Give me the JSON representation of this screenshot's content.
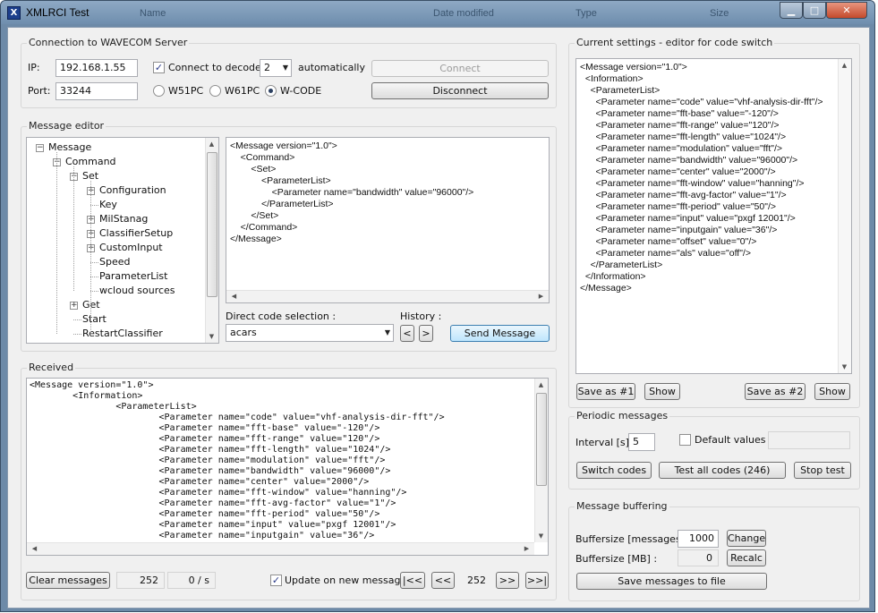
{
  "window": {
    "title": "XMLRCI Test",
    "bg_header": [
      "Name",
      "Date modified",
      "Type",
      "Size"
    ]
  },
  "connection": {
    "group_label": "Connection to WAVECOM Server",
    "ip_label": "IP:",
    "ip_value": "192.168.1.55",
    "port_label": "Port:",
    "port_value": "33244",
    "connect_decoder_label": "Connect to decoder",
    "connect_decoder_checked": true,
    "decoder_number": "2",
    "automatically_label": "automatically",
    "radio_w51pc": "W51PC",
    "radio_w61pc": "W61PC",
    "radio_wcode": "W-CODE",
    "selected_radio": "W-CODE",
    "connect_button": "Connect",
    "disconnect_button": "Disconnect"
  },
  "editor": {
    "group_label": "Message editor",
    "tree": [
      {
        "label": "Message",
        "toggle": "−"
      },
      {
        "label": "Command",
        "toggle": "−"
      },
      {
        "label": "Set",
        "toggle": "−"
      },
      {
        "label": "Configuration",
        "toggle": "+"
      },
      {
        "label": "Key",
        "toggle": ""
      },
      {
        "label": "MilStanag",
        "toggle": "+"
      },
      {
        "label": "ClassifierSetup",
        "toggle": "+"
      },
      {
        "label": "CustomInput",
        "toggle": "+"
      },
      {
        "label": "Speed",
        "toggle": ""
      },
      {
        "label": "ParameterList",
        "toggle": ""
      },
      {
        "label": "wcloud sources",
        "toggle": ""
      },
      {
        "label": "Get",
        "toggle": "+"
      },
      {
        "label": "Start",
        "toggle": ""
      },
      {
        "label": "RestartClassifier",
        "toggle": ""
      }
    ],
    "xml_lines": [
      "<Message version=\"1.0\">",
      "    <Command>",
      "        <Set>",
      "            <ParameterList>",
      "                <Parameter name=\"bandwidth\" value=\"96000\"/>",
      "            </ParameterList>",
      "        </Set>",
      "    </Command>",
      "</Message>"
    ],
    "direct_code_label": "Direct code selection :",
    "direct_code_value": "acars",
    "history_label": "History :",
    "history_prev": "<",
    "history_next": ">",
    "send_button": "Send Message"
  },
  "received": {
    "group_label": "Received",
    "lines": [
      "<Message version=\"1.0\">",
      "\t<Information>",
      "\t\t<ParameterList>",
      "\t\t\t<Parameter name=\"code\" value=\"vhf-analysis-dir-fft\"/>",
      "\t\t\t<Parameter name=\"fft-base\" value=\"-120\"/>",
      "\t\t\t<Parameter name=\"fft-range\" value=\"120\"/>",
      "\t\t\t<Parameter name=\"fft-length\" value=\"1024\"/>",
      "\t\t\t<Parameter name=\"modulation\" value=\"fft\"/>",
      "\t\t\t<Parameter name=\"bandwidth\" value=\"96000\"/>",
      "\t\t\t<Parameter name=\"center\" value=\"2000\"/>",
      "\t\t\t<Parameter name=\"fft-window\" value=\"hanning\"/>",
      "\t\t\t<Parameter name=\"fft-avg-factor\" value=\"1\"/>",
      "\t\t\t<Parameter name=\"fft-period\" value=\"50\"/>",
      "\t\t\t<Parameter name=\"input\" value=\"pxgf 12001\"/>",
      "\t\t\t<Parameter name=\"inputgain\" value=\"36\"/>"
    ],
    "clear_button": "Clear messages",
    "message_count": "252",
    "rate": "0 / s",
    "update_label": "Update on new message",
    "update_checked": true,
    "nav_first": "|<<",
    "nav_prev": "<<",
    "nav_position": "252",
    "nav_next": ">>",
    "nav_last": ">>|"
  },
  "current": {
    "group_label": "Current settings - editor for code switch",
    "lines": [
      "<Message version=\"1.0\">",
      "  <Information>",
      "    <ParameterList>",
      "      <Parameter name=\"code\" value=\"vhf-analysis-dir-fft\"/>",
      "      <Parameter name=\"fft-base\" value=\"-120\"/>",
      "      <Parameter name=\"fft-range\" value=\"120\"/>",
      "      <Parameter name=\"fft-length\" value=\"1024\"/>",
      "      <Parameter name=\"modulation\" value=\"fft\"/>",
      "      <Parameter name=\"bandwidth\" value=\"96000\"/>",
      "      <Parameter name=\"center\" value=\"2000\"/>",
      "      <Parameter name=\"fft-window\" value=\"hanning\"/>",
      "      <Parameter name=\"fft-avg-factor\" value=\"1\"/>",
      "      <Parameter name=\"fft-period\" value=\"50\"/>",
      "      <Parameter name=\"input\" value=\"pxgf 12001\"/>",
      "      <Parameter name=\"inputgain\" value=\"36\"/>",
      "      <Parameter name=\"offset\" value=\"0\"/>",
      "      <Parameter name=\"als\" value=\"off\"/>",
      "    </ParameterList>",
      "  </Information>",
      "</Message>"
    ],
    "save1_button": "Save as #1",
    "show1_button": "Show",
    "save2_button": "Save as #2",
    "show2_button": "Show"
  },
  "periodic": {
    "group_label": "Periodic messages",
    "interval_label": "Interval [s] :",
    "interval_value": "5",
    "default_values_label": "Default values",
    "default_values_checked": false,
    "switch_codes_button": "Switch codes",
    "test_all_button": "Test all codes (246)",
    "stop_test_button": "Stop test"
  },
  "buffering": {
    "group_label": "Message buffering",
    "buffersize_msgs_label": "Buffersize [messages] :",
    "buffersize_msgs_value": "1000",
    "change_button": "Change",
    "buffersize_mb_label": "Buffersize [MB] :",
    "buffersize_mb_value": "0",
    "recalc_button": "Recalc",
    "save_file_button": "Save messages to file"
  },
  "colors": {
    "title_bar": "#7d9aba",
    "close_button": "#c8452a",
    "client_bg": "#f0f0f0"
  }
}
